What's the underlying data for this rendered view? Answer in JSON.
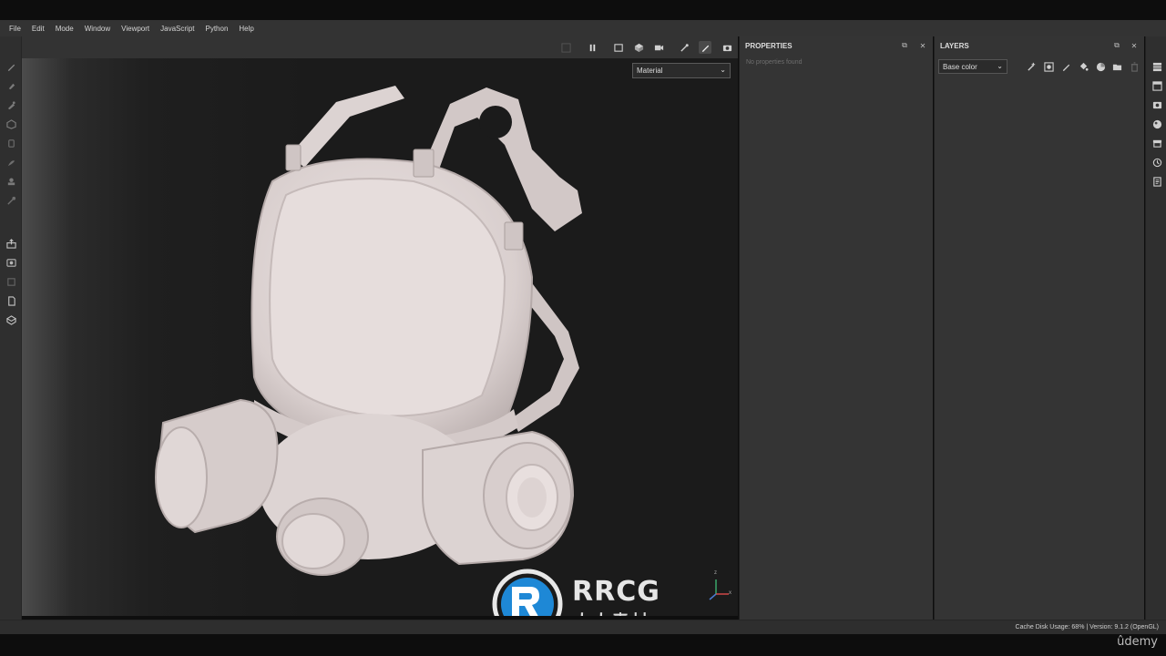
{
  "menu": [
    "File",
    "Edit",
    "Mode",
    "Window",
    "Viewport",
    "JavaScript",
    "Python",
    "Help"
  ],
  "viewport": {
    "material_select": "Material",
    "gizmo_axes": [
      "z",
      "x"
    ]
  },
  "properties": {
    "title": "PROPERTIES",
    "empty_text": "No properties found"
  },
  "layers": {
    "title": "LAYERS",
    "channel": "Base color"
  },
  "status": {
    "text": "Cache Disk Usage:   68% | Version: 9.1.2 (OpenGL)"
  },
  "watermark": {
    "title": "RRCG",
    "subtitle": "人人素材"
  },
  "udemy": "ûdemy",
  "colors": {
    "menubar": "#333333",
    "panel": "#343434",
    "viewport_bg": "#1b1b1b",
    "model": "#e8dedd",
    "watermark_blue": "#1e88d6"
  }
}
